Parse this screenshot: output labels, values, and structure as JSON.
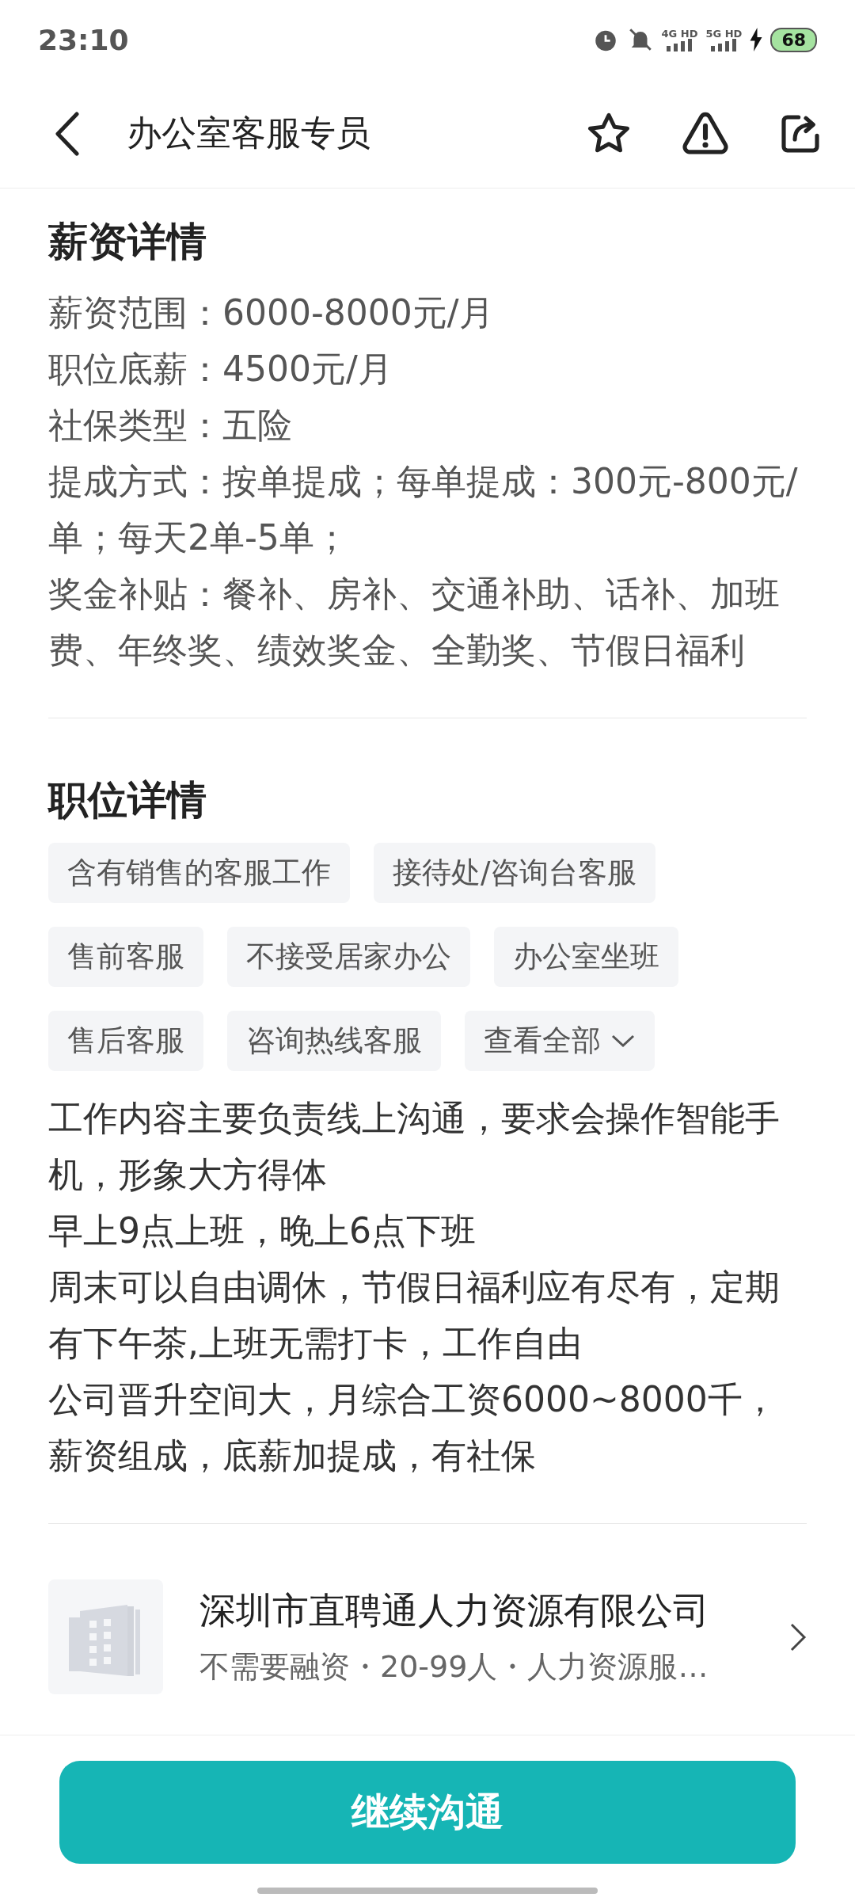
{
  "status_bar": {
    "time": "23:10",
    "network_1": "4G HD",
    "network_2": "5G HD",
    "battery": "68"
  },
  "header": {
    "title": "办公室客服专员"
  },
  "salary": {
    "title": "薪资详情",
    "lines": [
      "薪资范围：6000-8000元/月",
      "职位底薪：4500元/月",
      "社保类型：五险",
      "提成方式：按单提成；每单提成：300元-800元/单；每天2单-5单；",
      "奖金补贴：餐补、房补、交通补助、话补、加班费、年终奖、绩效奖金、全勤奖、节假日福利"
    ]
  },
  "position": {
    "title": "职位详情",
    "tags": [
      {
        "label": "含有销售的客服工作",
        "kind": "tag"
      },
      {
        "label": "接待处/咨询台客服",
        "kind": "tag"
      },
      {
        "label": "售前客服",
        "kind": "tag"
      },
      {
        "label": "不接受居家办公",
        "kind": "tag"
      },
      {
        "label": "办公室坐班",
        "kind": "tag"
      },
      {
        "label": "售后客服",
        "kind": "tag"
      },
      {
        "label": "咨询热线客服",
        "kind": "tag"
      },
      {
        "label": "查看全部",
        "kind": "more"
      }
    ],
    "description": [
      "工作内容主要负责线上沟通，要求会操作智能手机，形象大方得体",
      "早上9点上班，晚上6点下班",
      "周末可以自由调休，节假日福利应有尽有，定期有下午茶,上班无需打卡，工作自由",
      "公司晋升空间大，月综合工资6000~8000千，薪资组成，底薪加提成，有社保"
    ]
  },
  "company": {
    "name": "深圳市直聘通人力资源有限公司",
    "meta": "不需要融资・20-99人・人力资源服…"
  },
  "action": {
    "label": "继续沟通"
  }
}
